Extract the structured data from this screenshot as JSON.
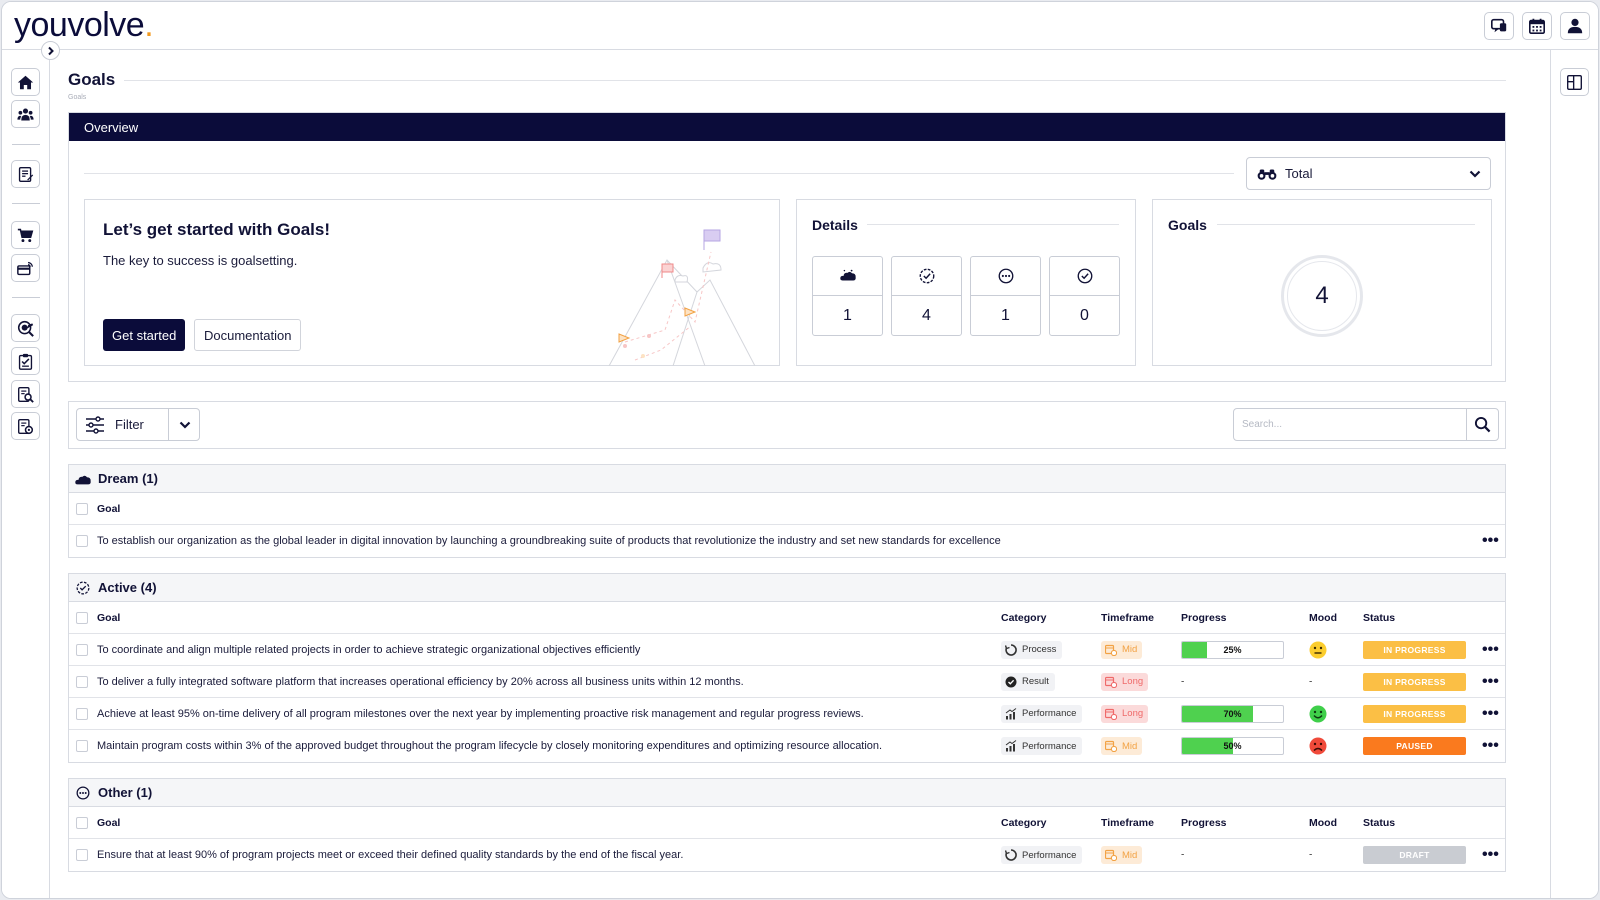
{
  "app": {
    "logo": "youvolve",
    "logo_dot": "."
  },
  "page": {
    "title": "Goals",
    "breadcrumb": "Goals"
  },
  "overview": {
    "header": "Overview",
    "select_value": "Total",
    "intro": {
      "title": "Let’s get started with Goals!",
      "subtitle": "The key to success is goalsetting.",
      "primary_button": "Get started",
      "secondary_button": "Documentation"
    },
    "details": {
      "title": "Details",
      "stats": [
        {
          "icon": "dream-cloud-icon",
          "value": "1"
        },
        {
          "icon": "active-check-icon",
          "value": "4"
        },
        {
          "icon": "other-dots-icon",
          "value": "1"
        },
        {
          "icon": "completed-check-icon",
          "value": "0"
        }
      ]
    },
    "goals": {
      "title": "Goals",
      "total": "4"
    }
  },
  "toolbar": {
    "filter_label": "Filter",
    "search_placeholder": "Search..."
  },
  "columns": {
    "goal": "Goal",
    "category": "Category",
    "timeframe": "Timeframe",
    "progress": "Progress",
    "mood": "Mood",
    "status": "Status"
  },
  "sections": {
    "dream": {
      "title": "Dream (1)",
      "rows": [
        {
          "goal": "To establish our organization as the global leader in digital innovation by launching a groundbreaking suite of products that revolutionize the industry and set new standards for excellence"
        }
      ]
    },
    "active": {
      "title": "Active (4)",
      "rows": [
        {
          "goal": "To coordinate and align multiple related projects in order to achieve strategic organizational objectives efficiently",
          "category": "Process",
          "timeframe": "Mid",
          "progress": "25%",
          "progress_value": 0.25,
          "mood": "neutral",
          "status": "IN PROGRESS"
        },
        {
          "goal": "To deliver a fully integrated software platform that increases operational efficiency by 20% across all business units within 12 months.",
          "category": "Result",
          "timeframe": "Long",
          "progress": "-",
          "mood": "-",
          "status": "IN PROGRESS"
        },
        {
          "goal": "Achieve at least 95% on-time delivery of all program milestones over the next year by implementing proactive risk management and regular progress reviews.",
          "category": "Performance",
          "timeframe": "Long",
          "progress": "70%",
          "progress_value": 0.7,
          "mood": "happy",
          "status": "IN PROGRESS"
        },
        {
          "goal": "Maintain program costs within 3% of the approved budget throughout the program lifecycle by closely monitoring expenditures and optimizing resource allocation.",
          "category": "Performance",
          "timeframe": "Mid",
          "progress": "50%",
          "progress_value": 0.5,
          "mood": "sad",
          "status": "PAUSED"
        }
      ]
    },
    "other": {
      "title": "Other (1)",
      "rows": [
        {
          "goal": "Ensure that at least 90% of program projects meet or exceed their defined quality standards by the end of the fiscal year.",
          "category": "Performance",
          "timeframe": "Mid",
          "progress": "-",
          "mood": "-",
          "status": "DRAFT"
        }
      ]
    }
  },
  "colors": {
    "navy": "#0b0c3a",
    "accent": "#f29a1f",
    "in_progress": "#fbbf45",
    "paused": "#fa7a1e",
    "draft": "#c9ccd2",
    "progress_fill": "#4fd14f"
  },
  "more_glyph": "•••"
}
